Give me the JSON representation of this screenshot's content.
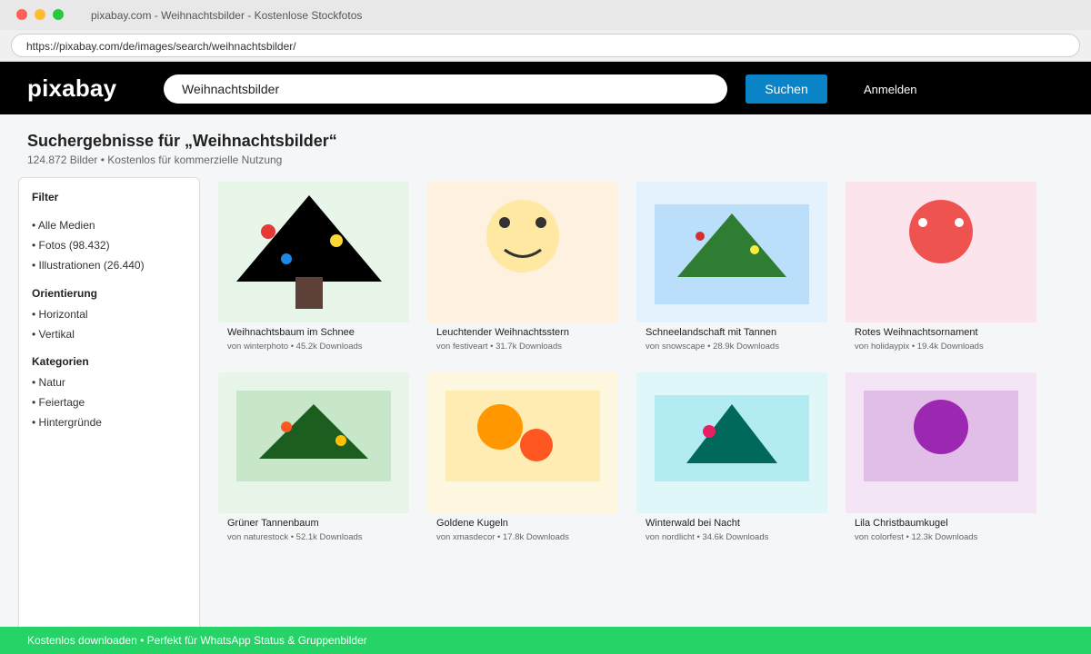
{
  "browser": {
    "tab_title": "pixabay.com - Weihnachtsbilder - Kostenlose Stockfotos",
    "url": "https://pixabay.com/de/images/search/weihnachtsbilder/"
  },
  "header": {
    "logo": "pixabay",
    "search_value": "Weihnachtsbilder",
    "search_button": "Suchen",
    "login": "Anmelden"
  },
  "results": {
    "title": "Suchergebnisse für „Weihnachtsbilder“",
    "subtitle": "124.872 Bilder • Kostenlos für kommerzielle Nutzung"
  },
  "sidebar": {
    "filter_heading": "Filter",
    "media": [
      "• Alle Medien",
      "• Fotos (98.432)",
      "• Illustrationen (26.440)"
    ],
    "orientation_heading": "Orientierung",
    "orientation": [
      "• Horizontal",
      "• Vertikal"
    ],
    "categories_heading": "Kategorien",
    "categories": [
      "• Natur",
      "• Feiertage",
      "• Hintergründe"
    ]
  },
  "images": [
    {
      "title": "Weihnachtsbaum im Schnee",
      "meta": "von winterphoto • 45.2k Downloads",
      "bg": "#e8f5e9"
    },
    {
      "title": "Leuchtender Weihnachtsstern",
      "meta": "von festiveart • 31.7k Downloads",
      "bg": "#fff1e0"
    },
    {
      "title": "Schneelandschaft mit Tannen",
      "meta": "von snowscape • 28.9k Downloads",
      "bg": "#e3f2fd"
    },
    {
      "title": "Rotes Weihnachtsornament",
      "meta": "von holidaypix • 19.4k Downloads",
      "bg": "#fce4ec"
    },
    {
      "title": "Grüner Tannenbaum",
      "meta": "von naturestock • 52.1k Downloads",
      "bg": "#e8f5e9"
    },
    {
      "title": "Goldene Kugeln",
      "meta": "von xmasdecor • 17.8k Downloads",
      "bg": "#fff8e1"
    },
    {
      "title": "Winterwald bei Nacht",
      "meta": "von nordlicht • 34.6k Downloads",
      "bg": "#e0f7fa"
    },
    {
      "title": "Lila Christbaumkugel",
      "meta": "von colorfest • 12.3k Downloads",
      "bg": "#f3e5f5"
    }
  ],
  "banner": {
    "text": "Kostenlos downloaden • Perfekt für WhatsApp Status & Gruppenbilder"
  },
  "colors": {
    "accent": "#0a84c6",
    "banner": "#25d366",
    "header": "#000000"
  }
}
